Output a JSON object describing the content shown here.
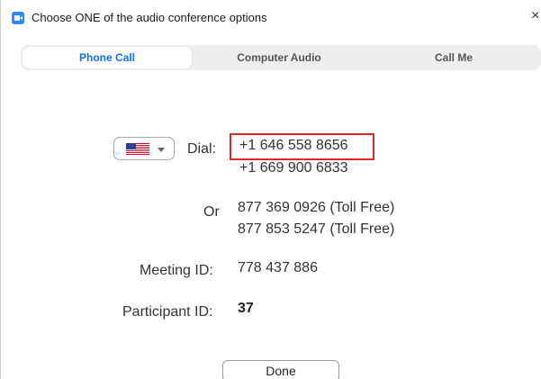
{
  "window": {
    "title": "Choose ONE of the audio conference options",
    "close_glyph": "×"
  },
  "tabs": [
    {
      "label": "Phone Call",
      "active": true
    },
    {
      "label": "Computer Audio",
      "active": false
    },
    {
      "label": "Call Me",
      "active": false
    }
  ],
  "dial": {
    "country_icon": "us-flag-icon",
    "label": "Dial:",
    "numbers": [
      "+1 646 558 8656",
      "+1 669 900 6833"
    ]
  },
  "or": {
    "label": "Or",
    "numbers": [
      "877 369 0926 (Toll Free)",
      "877 853 5247 (Toll Free)"
    ]
  },
  "meeting": {
    "label": "Meeting ID:",
    "value": "778 437 886"
  },
  "participant": {
    "label": "Participant ID:",
    "value": "37"
  },
  "done_label": "Done",
  "colors": {
    "accent": "#0e72ed",
    "highlight": "#e0242b",
    "tab_bg": "#eeeef1"
  }
}
